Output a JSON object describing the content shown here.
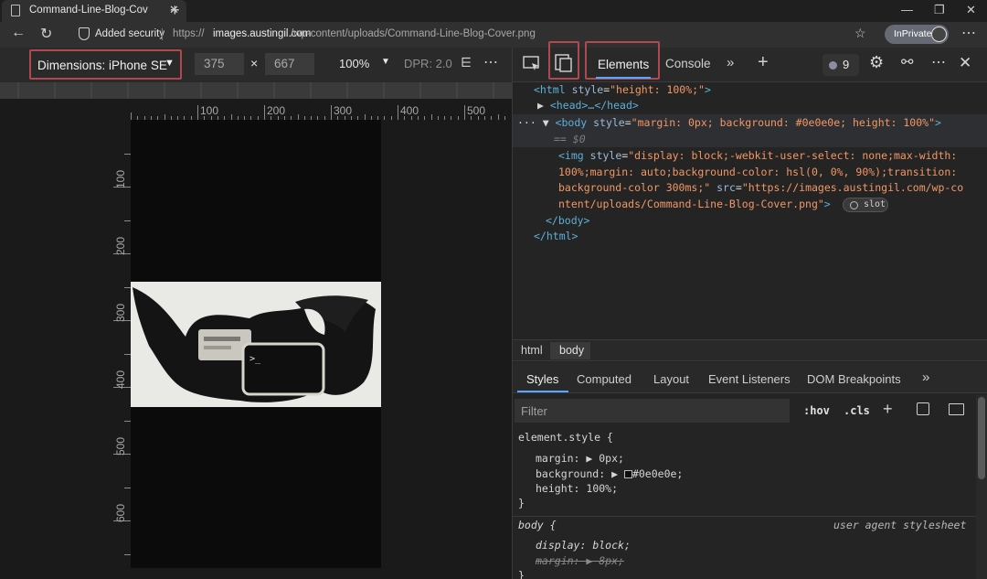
{
  "browser": {
    "tab_title": "Command-Line-Blog-Cover.png",
    "security_label": "Added security",
    "url_protocol": "https://",
    "url_host": "images.austingil.com",
    "url_path": "/wp-content/uploads/Command-Line-Blog-Cover.png",
    "inprivate_label": "InPrivate"
  },
  "device_toolbar": {
    "dimensions_label": "Dimensions: iPhone SE",
    "width": "375",
    "height": "667",
    "times": "×",
    "zoom": "100%",
    "dpr": "DPR: 2.0"
  },
  "rulers": {
    "horizontal": [
      "100",
      "200",
      "300",
      "400",
      "500"
    ],
    "vertical": [
      "100",
      "200",
      "300",
      "400",
      "500",
      "600"
    ]
  },
  "devtools": {
    "tabs": {
      "elements": "Elements",
      "console": "Console"
    },
    "issues_count": "9",
    "dom": {
      "html_open_tag": "<html",
      "html_attr": "style",
      "html_style": "\"height: 100%;\"",
      "head": "<head>…</head>",
      "body_open_tag": "<body",
      "body_attr": "style",
      "body_style": "\"margin: 0px; background: #0e0e0e; height: 100%\"",
      "body_dollar": "== $0",
      "img_line1_tag": "<img",
      "img_line1_attr": "style",
      "img_line1_val": "\"display: block;-webkit-user-select: none;max-width:",
      "img_line2": "100%;margin: auto;background-color: hsl(0, 0%, 90%);transition:",
      "img_line3_val": "background-color 300ms;\"",
      "img_line3_attr": "src",
      "img_line3_src": "\"https://images.austingil.com/wp-co",
      "img_line4_src": "ntent/uploads/Command-Line-Blog-Cover.png\"",
      "slot": "slot",
      "body_close": "</body>",
      "html_close": "</html>"
    },
    "breadcrumbs": [
      "html",
      "body"
    ],
    "subtabs": [
      "Styles",
      "Computed",
      "Layout",
      "Event Listeners",
      "DOM Breakpoints"
    ],
    "filter_placeholder": "Filter",
    "hov": ":hov",
    "cls": ".cls",
    "styles": {
      "element_style_selector": "element.style {",
      "rules": [
        {
          "prop": "margin",
          "value": "0px;"
        },
        {
          "prop": "background",
          "value": "#0e0e0e;"
        },
        {
          "prop": "height",
          "value": "100%;"
        }
      ],
      "close_brace": "}",
      "body_selector": "body {",
      "user_agent_label": "user agent stylesheet",
      "ua_rules": [
        {
          "prop": "display",
          "value": "block;"
        },
        {
          "prop": "margin",
          "value": "8px;"
        }
      ],
      "ua_close": "}"
    }
  },
  "colors": {
    "highlight_border": "#b0494f",
    "accent_underline": "#58a6ff",
    "page_background": "#0e0e0e"
  }
}
